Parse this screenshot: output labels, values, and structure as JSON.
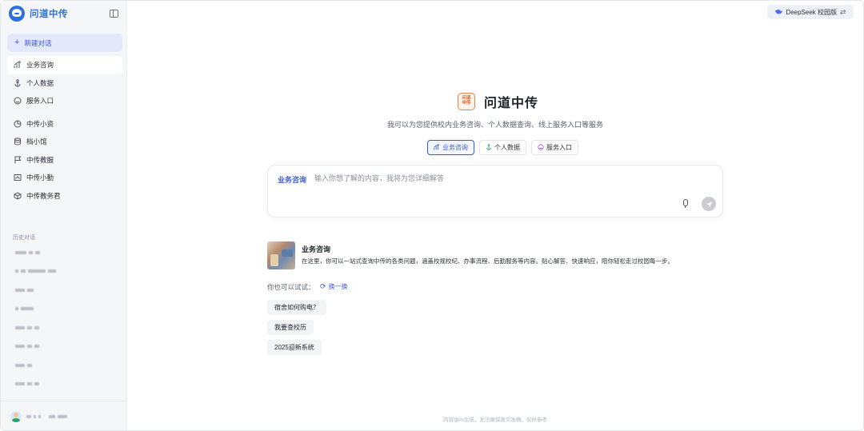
{
  "sidebar": {
    "brand": "问道中传",
    "new_chat": "新建对话",
    "items": [
      {
        "label": "业务咨询",
        "icon": "chart-icon"
      },
      {
        "label": "个人数据",
        "icon": "anchor-icon"
      },
      {
        "label": "服务入口",
        "icon": "smile-icon"
      },
      {
        "label": "中传小资",
        "icon": "pie-icon"
      },
      {
        "label": "档小馆",
        "icon": "database-icon"
      },
      {
        "label": "中传教服",
        "icon": "flag-icon"
      },
      {
        "label": "中传小勤",
        "icon": "id-card-icon"
      },
      {
        "label": "中传教务君",
        "icon": "cube-icon"
      }
    ],
    "history_title": "历史对话"
  },
  "header": {
    "version_badge": "DeepSeek 校园版"
  },
  "hero": {
    "logo_text": "问道中传",
    "title": "问道中传",
    "subtitle": "我可以为您提供校内业务咨询、个人数据查询、线上服务入口等服务"
  },
  "mode_chips": [
    {
      "label": "业务咨询",
      "icon": "chart-icon",
      "active": true
    },
    {
      "label": "个人数据",
      "icon": "anchor-icon",
      "active": false
    },
    {
      "label": "服务入口",
      "icon": "smile-icon",
      "active": false
    }
  ],
  "composer": {
    "mode": "业务咨询",
    "placeholder": "输入你想了解的内容，我将为您详细解答",
    "value": ""
  },
  "intro": {
    "title": "业务咨询",
    "description": "在这里，你可以一站式查询中传的各类问题，涵盖校规校纪、办事流程、后勤服务等内容。贴心解答、快速响应，陪你轻松走过校园每一步。"
  },
  "suggestions": {
    "label": "你也可以试试：",
    "refresh": "换一换",
    "items": [
      "宿舍如何购电？",
      "我要查校历",
      "2025迎新系统"
    ]
  },
  "footer_note": "内容由AI生成，无法确保真实准确，仅供参考",
  "colors": {
    "accent": "#3a5bd9",
    "brand": "#2e6fe0",
    "logo_orange": "#e8824a"
  }
}
